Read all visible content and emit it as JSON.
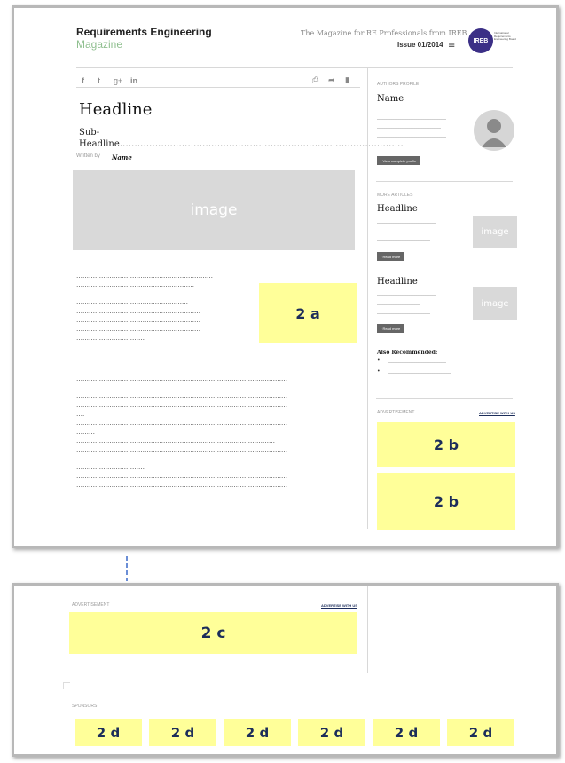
{
  "header": {
    "logo_line1": "Requirements Engineering",
    "logo_line2": "Magazine",
    "tagline": "The Magazine for RE Professionals from IREB",
    "issue": "Issue 01/2014",
    "menu_icon": "≡",
    "ireb_badge": "IREB",
    "ireb_text": "International Requirements Engineering Board"
  },
  "share_bar": {
    "icons": [
      "facebook-icon",
      "twitter-icon",
      "googleplus-icon",
      "linkedin-icon"
    ],
    "glyphs": [
      "f",
      "t",
      "g+",
      "in"
    ],
    "actions": [
      "print-icon",
      "share-icon",
      "bookmark-icon"
    ],
    "action_glyphs": [
      "⎙",
      "➦",
      "▮"
    ]
  },
  "article": {
    "headline": "Headline",
    "subheadline": "Sub-Headline……………………………………………………………………………………",
    "written_by": "Written by",
    "author": "Name",
    "image_label": "image",
    "ad_inline": "2 a",
    "para_lines_short": [
      "…………………………………………………………",
      "…………………………………………………",
      "……………………………………………………",
      "………………………………………………",
      "……………………………………………………",
      "……………………………………………………",
      "……………………………………………………",
      "……………………………"
    ],
    "para_lines_long": [
      "…………………………………………………………………………………………",
      "………",
      "…………………………………………………………………………………………",
      "…………………………………………………………………………………………",
      "….",
      "…………………………………………………………………………………………",
      "………",
      "……………………………………………………………………………………",
      "…………………………………………………………………………………………",
      "…………………………………………………………………………………………",
      "……………………………",
      "…………………………………………………………………………………………",
      "…………………………………………………………………………………………"
    ]
  },
  "sidebar": {
    "profile_label": "AUTHORS PROFILE",
    "profile_name": "Name",
    "profile_lines": [
      "…………………………………",
      "………………………………",
      "…………………………………"
    ],
    "profile_button": "› View complete profile",
    "more_label": "MORE ARTICLES",
    "articles": [
      {
        "headline": "Headline",
        "lines": [
          "……………………………",
          "……………………",
          "…………………………"
        ],
        "image": "image",
        "button": "› Read more"
      },
      {
        "headline": "Headline",
        "lines": [
          "……………………………",
          "……………………",
          "…………………………"
        ],
        "image": "image",
        "button": "› Read more"
      }
    ],
    "also_label": "Also Recommended:",
    "also_items": [
      "……………………………",
      "………………………………"
    ],
    "ad_label": "ADVERTISEMENT",
    "ad_link": "ADVERTISE WITH US",
    "ads": [
      "2 b",
      "2 b"
    ]
  },
  "bottom": {
    "ad_label": "ADVERTISEMENT",
    "ad_link": "ADVERTISE WITH US",
    "ad": "2 c",
    "sponsors_label": "SPONSORS",
    "sponsors": [
      "2 d",
      "2 d",
      "2 d",
      "2 d",
      "2 d",
      "2 d"
    ]
  },
  "colors": {
    "placeholder_yellow": "#ffff99",
    "placeholder_text": "#1c2d5a",
    "image_gray": "#d9d9d9",
    "logo_green": "#8fbf8f"
  }
}
